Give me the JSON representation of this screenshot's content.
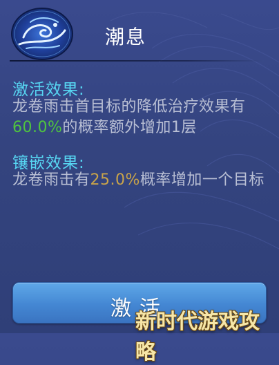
{
  "header": {
    "title": "潮息",
    "emblem_icon": "wave-emblem-icon"
  },
  "activation": {
    "label": "激活效果:",
    "desc_pre": "龙卷雨击首目标的降低治疗效果有",
    "desc_value": "60.0%",
    "desc_post": "的概率额外增加1层",
    "value_color": "#4fc43f"
  },
  "inlay": {
    "label": "镶嵌效果:",
    "desc_pre": "龙卷雨击有",
    "desc_value": "25.0%",
    "desc_post": "概率增加一个目标",
    "value_color": "#c9a44a"
  },
  "button": {
    "label": "激活"
  },
  "watermark": {
    "text": "新时代游戏攻略"
  },
  "colors": {
    "background": "#36467f",
    "section_label": "#57d6f2",
    "body_text": "#b9bfd4",
    "button": "#4487d3"
  }
}
